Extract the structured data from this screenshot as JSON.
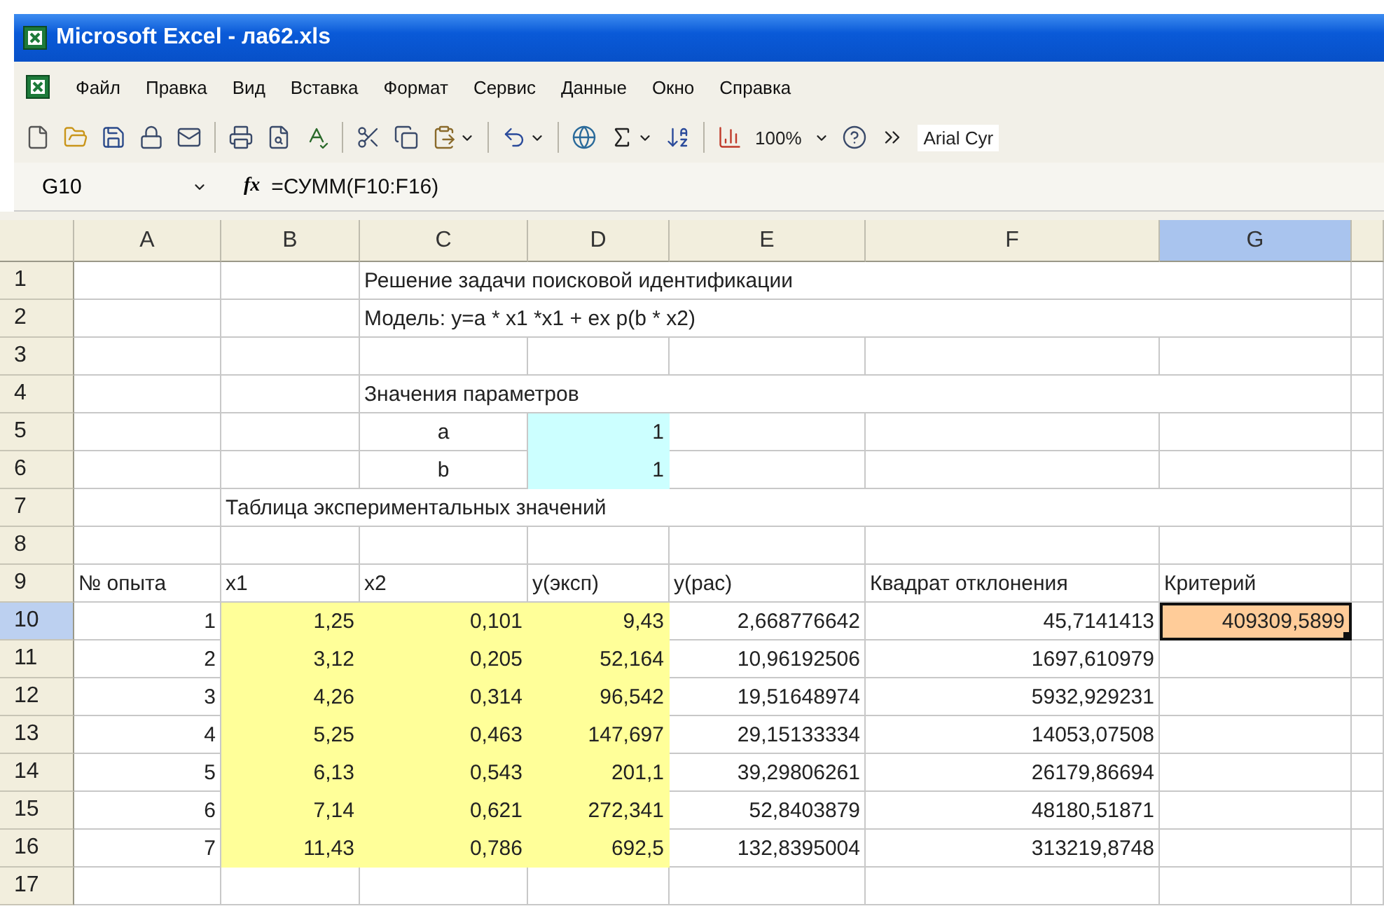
{
  "window": {
    "title": "Microsoft Excel - ла62.xls"
  },
  "menu": [
    "Файл",
    "Правка",
    "Вид",
    "Вставка",
    "Формат",
    "Сервис",
    "Данные",
    "Окно",
    "Справка"
  ],
  "toolbar": {
    "zoom": "100%",
    "font": "Arial Cyr"
  },
  "formula_bar": {
    "name_box": "G10",
    "function_label": "fx",
    "formula": "=СУММ(F10:F16)"
  },
  "columns": [
    {
      "label": "A",
      "selected": false
    },
    {
      "label": "B",
      "selected": false
    },
    {
      "label": "C",
      "selected": false
    },
    {
      "label": "D",
      "selected": false
    },
    {
      "label": "E",
      "selected": false
    },
    {
      "label": "F",
      "selected": false
    },
    {
      "label": "G",
      "selected": true
    }
  ],
  "rows": [
    {
      "header": "1",
      "selected": false,
      "cells": {
        "c": {
          "text": "Решение задачи поисковой идентификации",
          "kind": "text",
          "selected": false
        }
      }
    },
    {
      "header": "2",
      "selected": false,
      "cells": {
        "c": {
          "text": "Модель: y=a * x1 *x1 + ex p(b * x2)",
          "kind": "text",
          "selected": false
        }
      }
    },
    {
      "header": "3",
      "selected": false,
      "cells": {}
    },
    {
      "header": "4",
      "selected": false,
      "cells": {
        "c": {
          "text": "Значения параметров",
          "kind": "text",
          "selected": false
        }
      }
    },
    {
      "header": "5",
      "selected": false,
      "cells": {
        "c": {
          "text": "a",
          "kind": "label",
          "selected": false
        },
        "d": {
          "text": "1",
          "kind": "number",
          "color": "#ccffff",
          "selected": false
        }
      }
    },
    {
      "header": "6",
      "selected": false,
      "cells": {
        "c": {
          "text": "b",
          "kind": "label",
          "selected": false
        },
        "d": {
          "text": "1",
          "kind": "number",
          "color": "#ccffff",
          "selected": false
        }
      }
    },
    {
      "header": "7",
      "selected": false,
      "cells": {
        "b": {
          "text": "Таблица экспериментальных значений",
          "kind": "text",
          "selected": false
        }
      }
    },
    {
      "header": "8",
      "selected": false,
      "cells": {}
    },
    {
      "header": "9",
      "selected": false,
      "cells": {
        "a": {
          "text": "№ опыта",
          "kind": "text",
          "selected": false
        },
        "b": {
          "text": "x1",
          "kind": "text",
          "selected": false
        },
        "c": {
          "text": "x2",
          "kind": "text",
          "selected": false
        },
        "d": {
          "text": "y(эксп)",
          "kind": "text",
          "selected": false
        },
        "e": {
          "text": "y(рас)",
          "kind": "text",
          "selected": false
        },
        "f": {
          "text": "Квадрат отклонения",
          "kind": "text",
          "selected": false
        },
        "g": {
          "text": "Критерий",
          "kind": "text",
          "selected": false
        }
      }
    },
    {
      "header": "10",
      "selected": true,
      "cells": {
        "a": {
          "text": "1",
          "kind": "number",
          "selected": false
        },
        "b": {
          "text": "1,25",
          "kind": "number",
          "color": "#ffff99",
          "selected": false
        },
        "c": {
          "text": "0,101",
          "kind": "number",
          "color": "#ffff99",
          "selected": false
        },
        "d": {
          "text": "9,43",
          "kind": "number",
          "color": "#ffff99",
          "selected": false
        },
        "e": {
          "text": "2,668776642",
          "kind": "number",
          "selected": false
        },
        "f": {
          "text": "45,7141413",
          "kind": "number",
          "selected": false
        },
        "g": {
          "text": "409309,5899",
          "kind": "number",
          "color": "#ffcc99",
          "selected": true
        }
      }
    },
    {
      "header": "11",
      "selected": false,
      "cells": {
        "a": {
          "text": "2",
          "kind": "number",
          "selected": false
        },
        "b": {
          "text": "3,12",
          "kind": "number",
          "color": "#ffff99",
          "selected": false
        },
        "c": {
          "text": "0,205",
          "kind": "number",
          "color": "#ffff99",
          "selected": false
        },
        "d": {
          "text": "52,164",
          "kind": "number",
          "color": "#ffff99",
          "selected": false
        },
        "e": {
          "text": "10,96192506",
          "kind": "number",
          "selected": false
        },
        "f": {
          "text": "1697,610979",
          "kind": "number",
          "selected": false
        }
      }
    },
    {
      "header": "12",
      "selected": false,
      "cells": {
        "a": {
          "text": "3",
          "kind": "number",
          "selected": false
        },
        "b": {
          "text": "4,26",
          "kind": "number",
          "color": "#ffff99",
          "selected": false
        },
        "c": {
          "text": "0,314",
          "kind": "number",
          "color": "#ffff99",
          "selected": false
        },
        "d": {
          "text": "96,542",
          "kind": "number",
          "color": "#ffff99",
          "selected": false
        },
        "e": {
          "text": "19,51648974",
          "kind": "number",
          "selected": false
        },
        "f": {
          "text": "5932,929231",
          "kind": "number",
          "selected": false
        }
      }
    },
    {
      "header": "13",
      "selected": false,
      "cells": {
        "a": {
          "text": "4",
          "kind": "number",
          "selected": false
        },
        "b": {
          "text": "5,25",
          "kind": "number",
          "color": "#ffff99",
          "selected": false
        },
        "c": {
          "text": "0,463",
          "kind": "number",
          "color": "#ffff99",
          "selected": false
        },
        "d": {
          "text": "147,697",
          "kind": "number",
          "color": "#ffff99",
          "selected": false
        },
        "e": {
          "text": "29,15133334",
          "kind": "number",
          "selected": false
        },
        "f": {
          "text": "14053,07508",
          "kind": "number",
          "selected": false
        }
      }
    },
    {
      "header": "14",
      "selected": false,
      "cells": {
        "a": {
          "text": "5",
          "kind": "number",
          "selected": false
        },
        "b": {
          "text": "6,13",
          "kind": "number",
          "color": "#ffff99",
          "selected": false
        },
        "c": {
          "text": "0,543",
          "kind": "number",
          "color": "#ffff99",
          "selected": false
        },
        "d": {
          "text": "201,1",
          "kind": "number",
          "color": "#ffff99",
          "selected": false
        },
        "e": {
          "text": "39,29806261",
          "kind": "number",
          "selected": false
        },
        "f": {
          "text": "26179,86694",
          "kind": "number",
          "selected": false
        }
      }
    },
    {
      "header": "15",
      "selected": false,
      "cells": {
        "a": {
          "text": "6",
          "kind": "number",
          "selected": false
        },
        "b": {
          "text": "7,14",
          "kind": "number",
          "color": "#ffff99",
          "selected": false
        },
        "c": {
          "text": "0,621",
          "kind": "number",
          "color": "#ffff99",
          "selected": false
        },
        "d": {
          "text": "272,341",
          "kind": "number",
          "color": "#ffff99",
          "selected": false
        },
        "e": {
          "text": "52,8403879",
          "kind": "number",
          "selected": false
        },
        "f": {
          "text": "48180,51871",
          "kind": "number",
          "selected": false
        }
      }
    },
    {
      "header": "16",
      "selected": false,
      "cells": {
        "a": {
          "text": "7",
          "kind": "number",
          "selected": false
        },
        "b": {
          "text": "11,43",
          "kind": "number",
          "color": "#ffff99",
          "selected": false
        },
        "c": {
          "text": "0,786",
          "kind": "number",
          "color": "#ffff99",
          "selected": false
        },
        "d": {
          "text": "692,5",
          "kind": "number",
          "color": "#ffff99",
          "selected": false
        },
        "e": {
          "text": "132,8395004",
          "kind": "number",
          "selected": false
        },
        "f": {
          "text": "313219,8748",
          "kind": "number",
          "selected": false
        }
      }
    },
    {
      "header": "17",
      "selected": false,
      "cells": {}
    }
  ]
}
